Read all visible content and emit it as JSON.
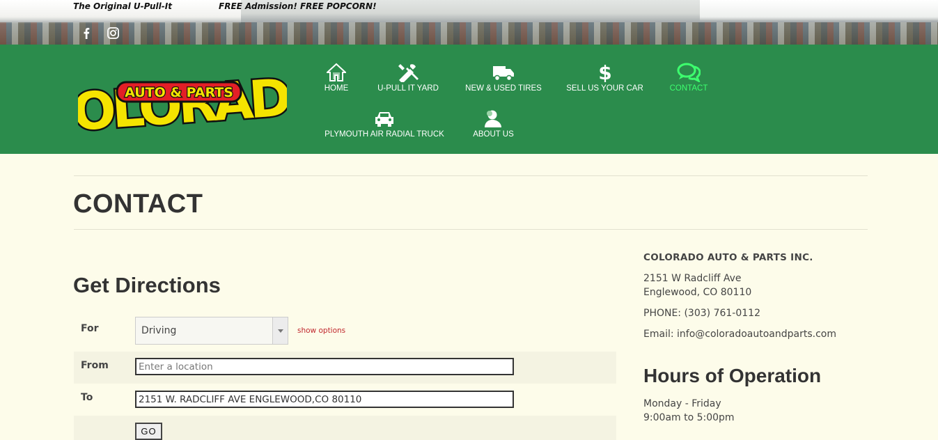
{
  "topbar": {
    "tagline": "The Original U-Pull-It",
    "promo": "FREE Admission! FREE POPCORN!",
    "social": [
      "facebook-icon",
      "instagram-icon"
    ]
  },
  "logo": {
    "word": "COLORADO",
    "sub": "AUTO & PARTS"
  },
  "nav": {
    "items": [
      {
        "label": "HOME",
        "icon": "home-icon"
      },
      {
        "label": "U-PULL IT YARD",
        "icon": "tools-icon"
      },
      {
        "label": "NEW & USED TIRES",
        "icon": "truck-icon"
      },
      {
        "label": "SELL US YOUR CAR",
        "icon": "dollar-icon"
      },
      {
        "label": "CONTACT",
        "icon": "chat-icon",
        "active": true
      },
      {
        "label": "PLYMOUTH AIR RADIAL TRUCK",
        "icon": "car-icon"
      },
      {
        "label": "ABOUT US",
        "icon": "person-icon"
      }
    ]
  },
  "page": {
    "title": "CONTACT"
  },
  "directions": {
    "title": "Get Directions",
    "for_label": "For",
    "mode": "Driving",
    "show_options": "show options",
    "from_label": "From",
    "from_placeholder": "Enter a location",
    "to_label": "To",
    "to_value": "2151 W. RADCLIFF AVE ENGLEWOOD,CO 80110",
    "go_label": "GO"
  },
  "company": {
    "name": "COLORADO AUTO & PARTS INC.",
    "address1": "2151 W Radcliff Ave",
    "address2": "Englewood, CO 80110",
    "phone": "PHONE: (303) 761-0112",
    "email": "Email: info@coloradoautoandparts.com"
  },
  "hours": {
    "title": "Hours of Operation",
    "days": "Monday - Friday",
    "time": "9:00am to 5:00pm"
  },
  "colors": {
    "header_green": "#2b8c4c",
    "active_nav": "#3dff6e",
    "page_bg": "#fdfcea",
    "link_red": "#c0272d"
  }
}
